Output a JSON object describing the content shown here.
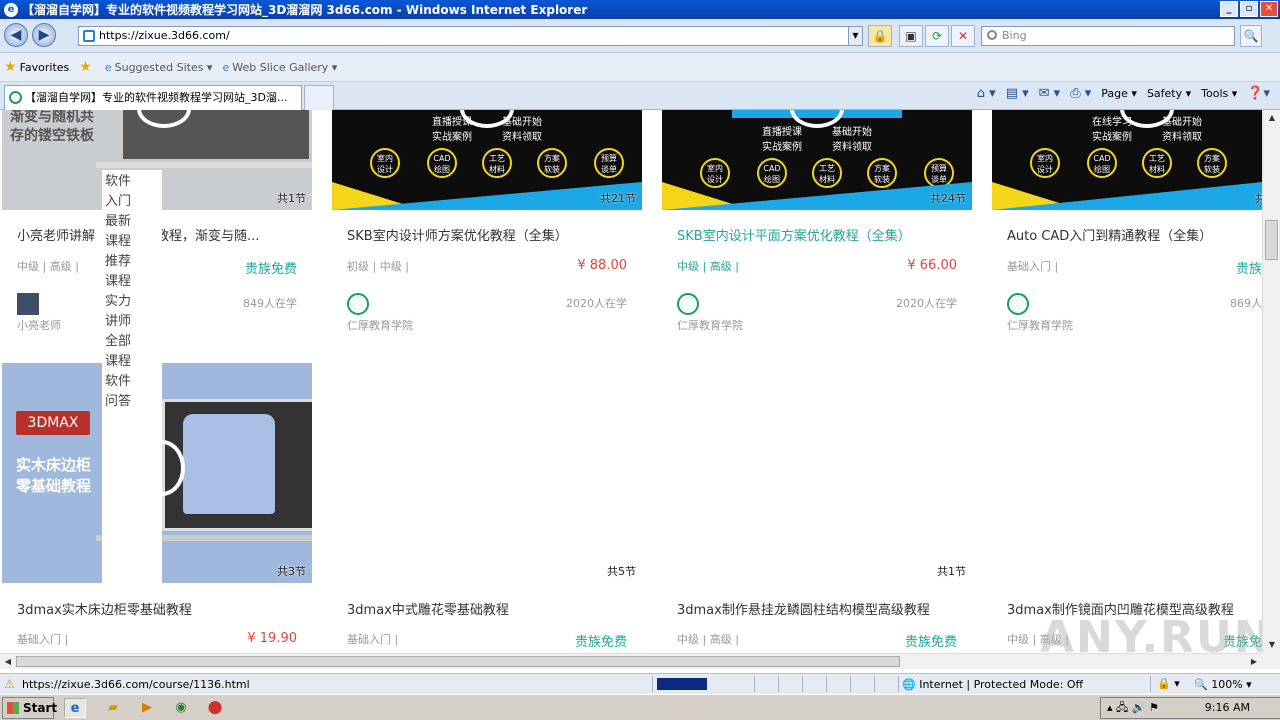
{
  "window": {
    "title": "【溜溜自学网】专业的软件视频教程学习网站_3D溜溜网 3d66.com - Windows Internet Explorer",
    "controls": [
      "_",
      "▫",
      "✕"
    ]
  },
  "address": {
    "url": "https://zixue.3d66.com/",
    "search_placeholder": "Bing"
  },
  "favorites_bar": {
    "favorites_label": "Favorites",
    "suggested_sites": "Suggested Sites ▾",
    "web_slice_gallery": "Web Slice Gallery ▾"
  },
  "tabs": [
    {
      "label": "【溜溜自学网】专业的软件视频教程学习网站_3D溜..."
    }
  ],
  "command_bar": {
    "page": "Page ▾",
    "safety": "Safety ▾",
    "tools": "Tools ▾"
  },
  "side_menu": [
    "软件",
    "入门",
    "最新",
    "课程",
    "推荐",
    "课程",
    "实力",
    "讲师",
    "全部",
    "课程",
    "软件",
    "问答"
  ],
  "row1": [
    {
      "banner_text": "渐变与随机共\n存的镂空铁板",
      "lessons": "共1节",
      "title": "小亮老师讲解",
      "title_rest": "端教程，渐变与随...",
      "level": "中级 | 高级 |",
      "price": "贵族免费",
      "students": "849人在学",
      "author": "小亮老师"
    },
    {
      "banner_items": [
        "直播授课",
        "基础开始",
        "实战案例",
        "资料领取"
      ],
      "circles": [
        "室内\n设计",
        "CAD\n绘图",
        "工艺\n材料",
        "方案\n软装",
        "预算\n谈单"
      ],
      "lessons": "共21节",
      "title": "SKB室内设计师方案优化教程（全集）",
      "level": "初级 | 中级 |",
      "price": "¥ 88.00",
      "students": "2020人在学",
      "author": "仁厚教育学院"
    },
    {
      "banner_items": [
        "直播授课",
        "基础开始",
        "实战案例",
        "资料领取"
      ],
      "circles": [
        "室内\n设计",
        "CAD\n绘图",
        "工艺\n材料",
        "方案\n软装",
        "预算\n谈单"
      ],
      "lessons": "共24节",
      "title": "SKB室内设计平面方案优化教程（全集）",
      "level": "中级 | 高级 |",
      "price": "¥ 66.00",
      "students": "2020人在学",
      "author": "仁厚教育学院"
    },
    {
      "banner_items": [
        "在线学习",
        "基础开始",
        "实战案例",
        "资料领取"
      ],
      "circles": [
        "室内\n设计",
        "CAD\n绘图",
        "工艺\n材料",
        "方案\n软装",
        "预算\n谈单"
      ],
      "lessons": "共",
      "title": "Auto CAD入门到精通教程（全集）",
      "level": "基础入门 |",
      "price": "贵族",
      "students": "869人",
      "author": "仁厚教育学院"
    }
  ],
  "row2": [
    {
      "badge": "3DMAX",
      "banner_text": "实木床边柜\n零基础教程",
      "lessons": "共3节",
      "title": "3dmax实木床边柜零基础教程",
      "level": "基础入门 |",
      "price": "¥ 19.90"
    },
    {
      "lessons": "共5节",
      "title": "3dmax中式雕花零基础教程",
      "level": "基础入门 |",
      "price": "贵族免费"
    },
    {
      "lessons": "共1节",
      "title": "3dmax制作悬挂龙鳞圆柱结构模型高级教程",
      "level": "中级 | 高级 |",
      "price": "贵族免费"
    },
    {
      "title": "3dmax制作镜面内凹雕花模型高级教程",
      "level": "中级 | 高级 |",
      "price": "贵族免"
    }
  ],
  "status": {
    "url": "https://zixue.3d66.com/course/1136.html",
    "zone": "Internet | Protected Mode: Off",
    "zoom": "100%"
  },
  "taskbar": {
    "start": "Start",
    "clock": "9:16 AM"
  },
  "watermark": "ANY.RUN",
  "colors": {
    "accent_teal": "#1fa89a",
    "price_red": "#e2453a",
    "title_bar": "#0a58d6"
  }
}
